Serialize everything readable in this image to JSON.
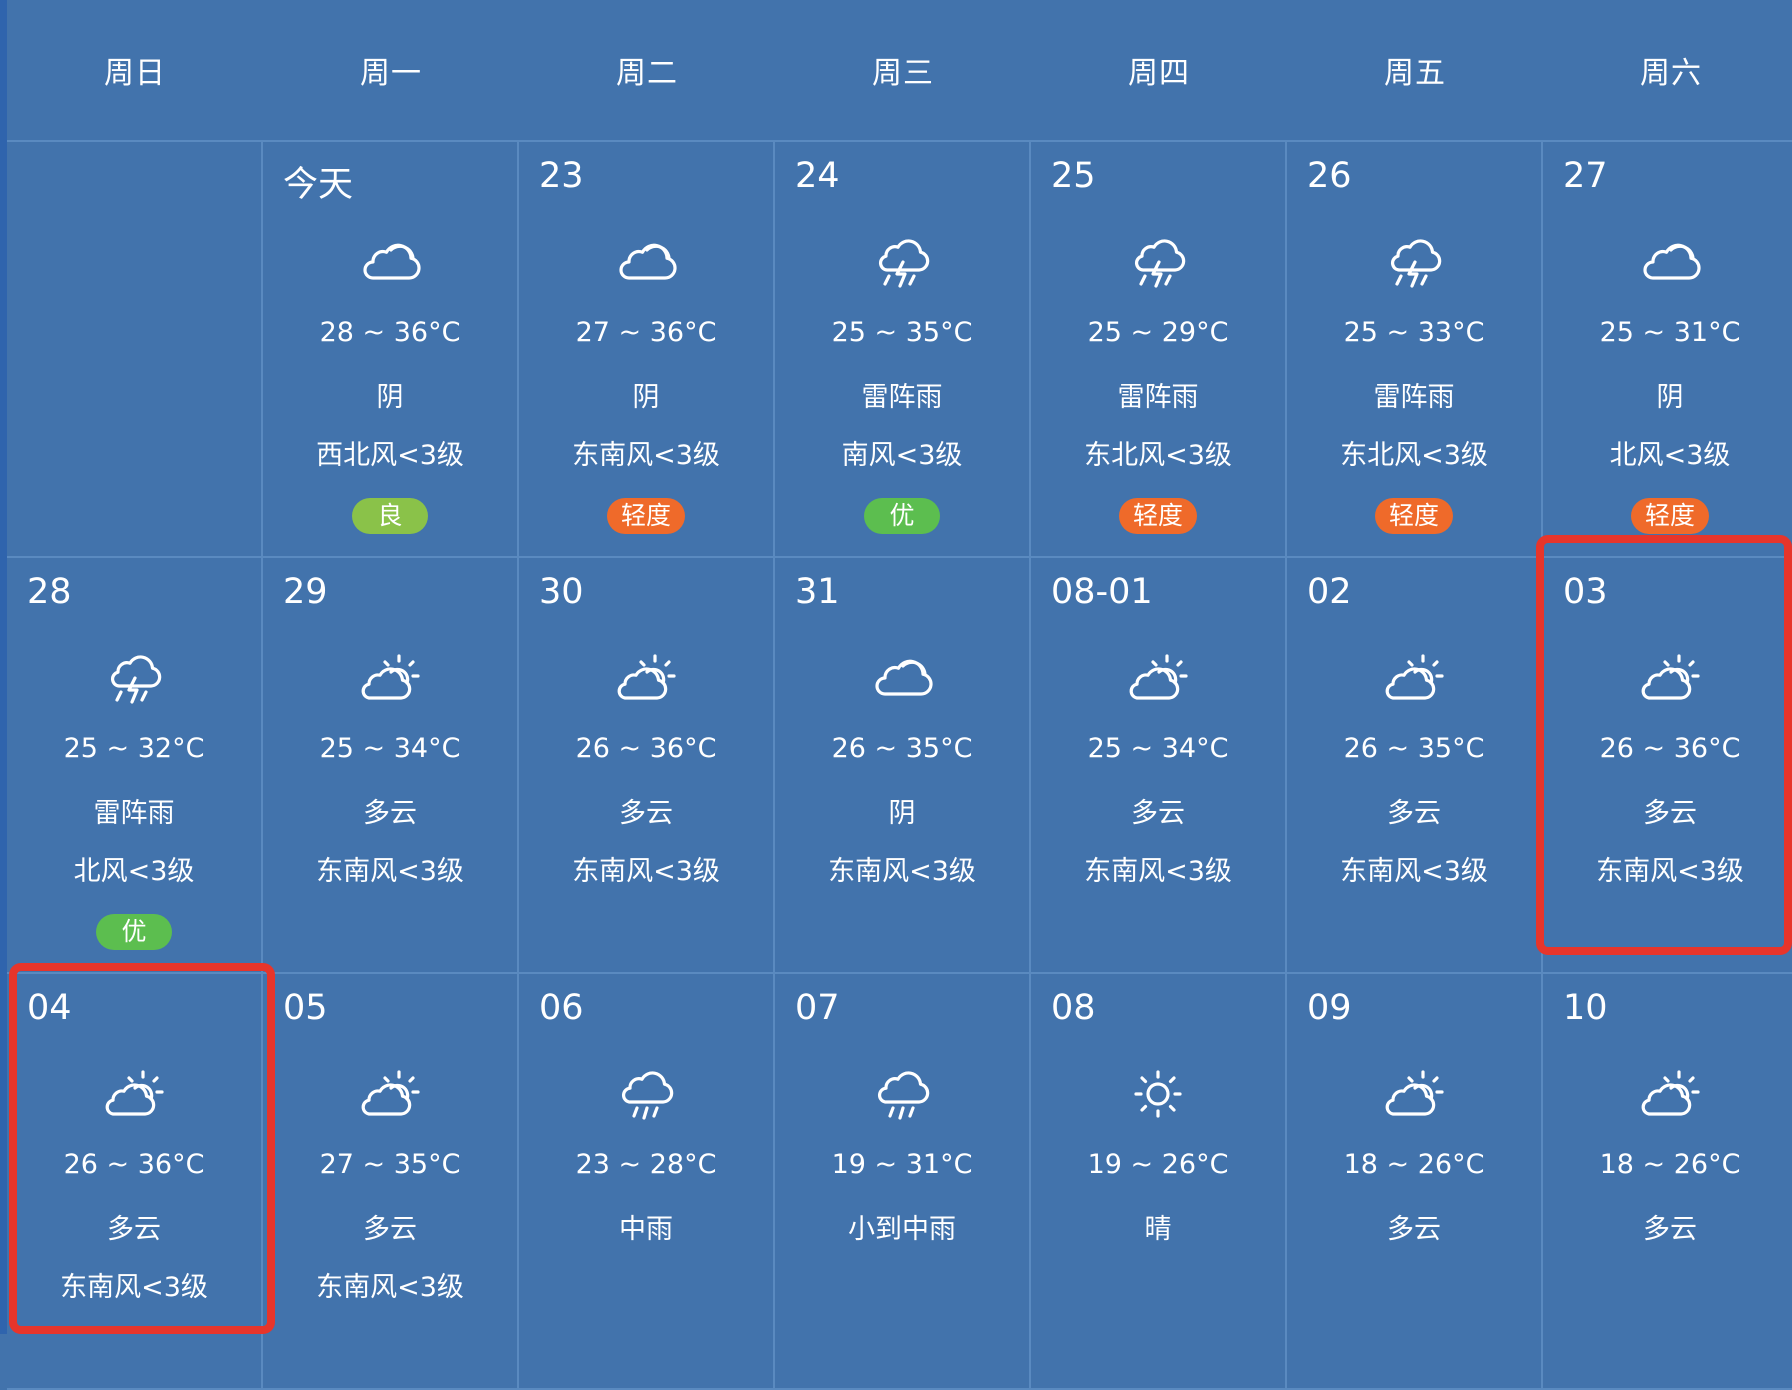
{
  "weekdays": [
    "周日",
    "周一",
    "周二",
    "周三",
    "周四",
    "周五",
    "周六"
  ],
  "days": [
    {
      "date": "",
      "icon": "none",
      "temp": "",
      "condition": "",
      "wind": "",
      "aqi": "",
      "aqi_color": ""
    },
    {
      "date": "今天",
      "icon": "cloudy-icon",
      "temp": "28 ~ 36°C",
      "condition": "阴",
      "wind": "西北风<3级",
      "aqi": "良",
      "aqi_color": "#8ac249"
    },
    {
      "date": "23",
      "icon": "cloudy-icon",
      "temp": "27 ~ 36°C",
      "condition": "阴",
      "wind": "东南风<3级",
      "aqi": "轻度",
      "aqi_color": "#ef6a2a"
    },
    {
      "date": "24",
      "icon": "thunderstorm-icon",
      "temp": "25 ~ 35°C",
      "condition": "雷阵雨",
      "wind": "南风<3级",
      "aqi": "优",
      "aqi_color": "#5cbe4f"
    },
    {
      "date": "25",
      "icon": "thunderstorm-icon",
      "temp": "25 ~ 29°C",
      "condition": "雷阵雨",
      "wind": "东北风<3级",
      "aqi": "轻度",
      "aqi_color": "#ef6a2a"
    },
    {
      "date": "26",
      "icon": "thunderstorm-icon",
      "temp": "25 ~ 33°C",
      "condition": "雷阵雨",
      "wind": "东北风<3级",
      "aqi": "轻度",
      "aqi_color": "#ef6a2a"
    },
    {
      "date": "27",
      "icon": "cloudy-icon",
      "temp": "25 ~ 31°C",
      "condition": "阴",
      "wind": "北风<3级",
      "aqi": "轻度",
      "aqi_color": "#ef6a2a"
    },
    {
      "date": "28",
      "icon": "thunderstorm-icon",
      "temp": "25 ~ 32°C",
      "condition": "雷阵雨",
      "wind": "北风<3级",
      "aqi": "优",
      "aqi_color": "#5cbe4f"
    },
    {
      "date": "29",
      "icon": "partly-cloudy-icon",
      "temp": "25 ~ 34°C",
      "condition": "多云",
      "wind": "东南风<3级",
      "aqi": "",
      "aqi_color": ""
    },
    {
      "date": "30",
      "icon": "partly-cloudy-icon",
      "temp": "26 ~ 36°C",
      "condition": "多云",
      "wind": "东南风<3级",
      "aqi": "",
      "aqi_color": ""
    },
    {
      "date": "31",
      "icon": "cloudy-icon",
      "temp": "26 ~ 35°C",
      "condition": "阴",
      "wind": "东南风<3级",
      "aqi": "",
      "aqi_color": ""
    },
    {
      "date": "08-01",
      "icon": "partly-cloudy-icon",
      "temp": "25 ~ 34°C",
      "condition": "多云",
      "wind": "东南风<3级",
      "aqi": "",
      "aqi_color": ""
    },
    {
      "date": "02",
      "icon": "partly-cloudy-icon",
      "temp": "26 ~ 35°C",
      "condition": "多云",
      "wind": "东南风<3级",
      "aqi": "",
      "aqi_color": ""
    },
    {
      "date": "03",
      "icon": "partly-cloudy-icon",
      "temp": "26 ~ 36°C",
      "condition": "多云",
      "wind": "东南风<3级",
      "aqi": "",
      "aqi_color": ""
    },
    {
      "date": "04",
      "icon": "partly-cloudy-icon",
      "temp": "26 ~ 36°C",
      "condition": "多云",
      "wind": "东南风<3级",
      "aqi": "",
      "aqi_color": ""
    },
    {
      "date": "05",
      "icon": "partly-cloudy-icon",
      "temp": "27 ~ 35°C",
      "condition": "多云",
      "wind": "东南风<3级",
      "aqi": "",
      "aqi_color": ""
    },
    {
      "date": "06",
      "icon": "rain-icon",
      "temp": "23 ~ 28°C",
      "condition": "中雨",
      "wind": "",
      "aqi": "",
      "aqi_color": ""
    },
    {
      "date": "07",
      "icon": "rain-icon",
      "temp": "19 ~ 31°C",
      "condition": "小到中雨",
      "wind": "",
      "aqi": "",
      "aqi_color": ""
    },
    {
      "date": "08",
      "icon": "sun-icon",
      "temp": "19 ~ 26°C",
      "condition": "晴",
      "wind": "",
      "aqi": "",
      "aqi_color": ""
    },
    {
      "date": "09",
      "icon": "partly-cloudy-icon",
      "temp": "18 ~ 26°C",
      "condition": "多云",
      "wind": "",
      "aqi": "",
      "aqi_color": ""
    },
    {
      "date": "10",
      "icon": "partly-cloudy-icon",
      "temp": "18 ~ 26°C",
      "condition": "多云",
      "wind": "",
      "aqi": "",
      "aqi_color": ""
    }
  ],
  "highlighted_dates": [
    "03",
    "04"
  ],
  "colors": {
    "background": "#4273ac",
    "grid_line": "#5a8ac0",
    "highlight": "#e7352b"
  }
}
